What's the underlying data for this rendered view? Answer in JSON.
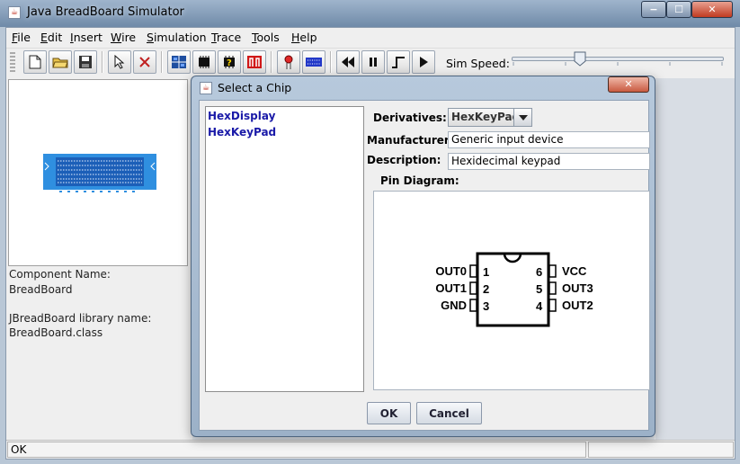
{
  "window": {
    "title": "Java BreadBoard Simulator",
    "icon": "java-cup-icon",
    "controls": {
      "minimize": "−",
      "maximize": "☐",
      "close": "✕"
    }
  },
  "menu": [
    "File",
    "Edit",
    "Insert",
    "Wire",
    "Simulation",
    "Trace",
    "Tools",
    "Help"
  ],
  "toolbar": {
    "icons": [
      "new-file-icon",
      "open-folder-icon",
      "save-icon",
      "select-arrow-icon",
      "delete-icon",
      "grid-icon",
      "chip-icon",
      "unknown-chip-icon",
      "switch-icon",
      "led-icon",
      "breadboard-icon",
      "rewind-icon",
      "pause-icon",
      "step-icon",
      "play-icon"
    ],
    "speed_label": "Sim Speed:",
    "speed_value": 0.32
  },
  "left_panel": {
    "component_name_label": "Component Name:",
    "component_name": "BreadBoard",
    "library_label": "JBreadBoard library name:",
    "library_name": "BreadBoard.class"
  },
  "status": {
    "text": "OK"
  },
  "dialog": {
    "title": "Select a Chip",
    "close": "✕",
    "chips": [
      "HexDisplay",
      "HexKeyPad"
    ],
    "derivatives_label": "Derivatives:",
    "derivatives_value": "HexKeyPad",
    "manufacturer_label": "Manufacturer:",
    "manufacturer_value": "Generic input device",
    "description_label": "Description:",
    "description_value": "Hexidecimal keypad",
    "pin_diagram_label": "Pin Diagram:",
    "pins_left": [
      {
        "name": "OUT0",
        "num": "1"
      },
      {
        "name": "OUT1",
        "num": "2"
      },
      {
        "name": "GND",
        "num": "3"
      }
    ],
    "pins_right": [
      {
        "name": "VCC",
        "num": "6"
      },
      {
        "name": "OUT3",
        "num": "5"
      },
      {
        "name": "OUT2",
        "num": "4"
      }
    ],
    "ok_label": "OK",
    "cancel_label": "Cancel"
  },
  "colors": {
    "accent": "#1e6fc8",
    "chip_link": "#1a1aa8",
    "breadboard": "#2f8fe0"
  }
}
